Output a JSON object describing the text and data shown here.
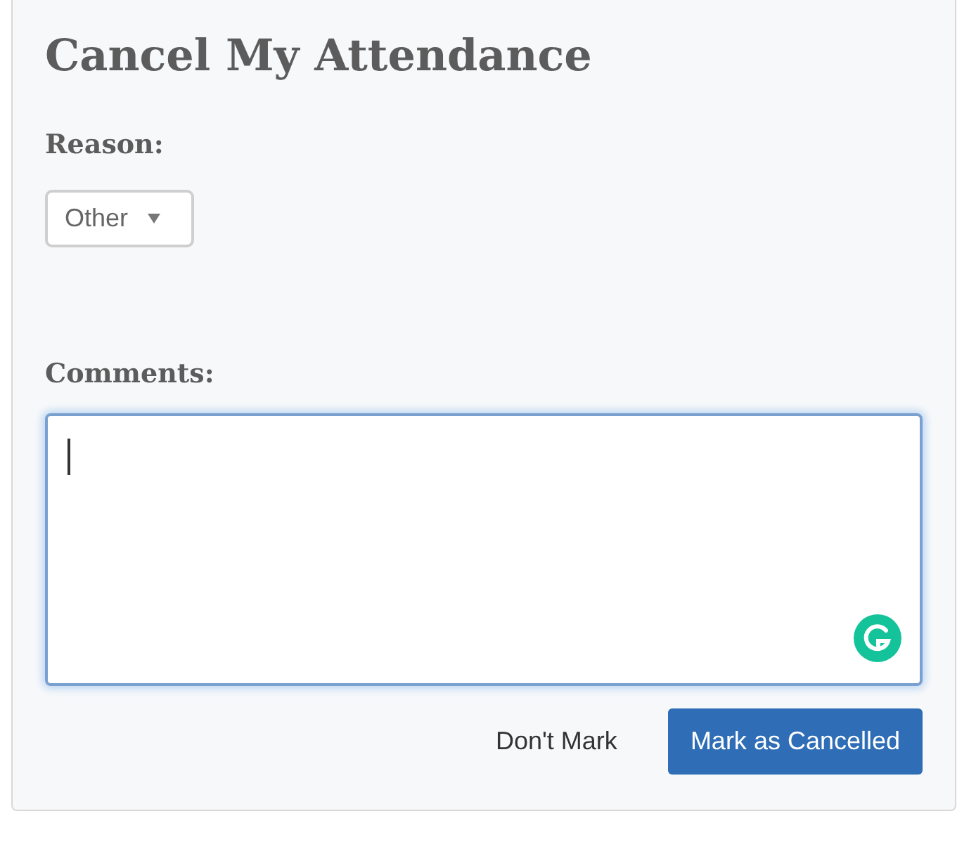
{
  "title": "Cancel My Attendance",
  "reason": {
    "label": "Reason:",
    "value": "Other"
  },
  "comments": {
    "label": "Comments:",
    "focused": true
  },
  "buttons": [
    {
      "label": "Don't Mark",
      "kind": "link"
    },
    {
      "label": "Mark as Cancelled",
      "kind": "primary"
    }
  ]
}
